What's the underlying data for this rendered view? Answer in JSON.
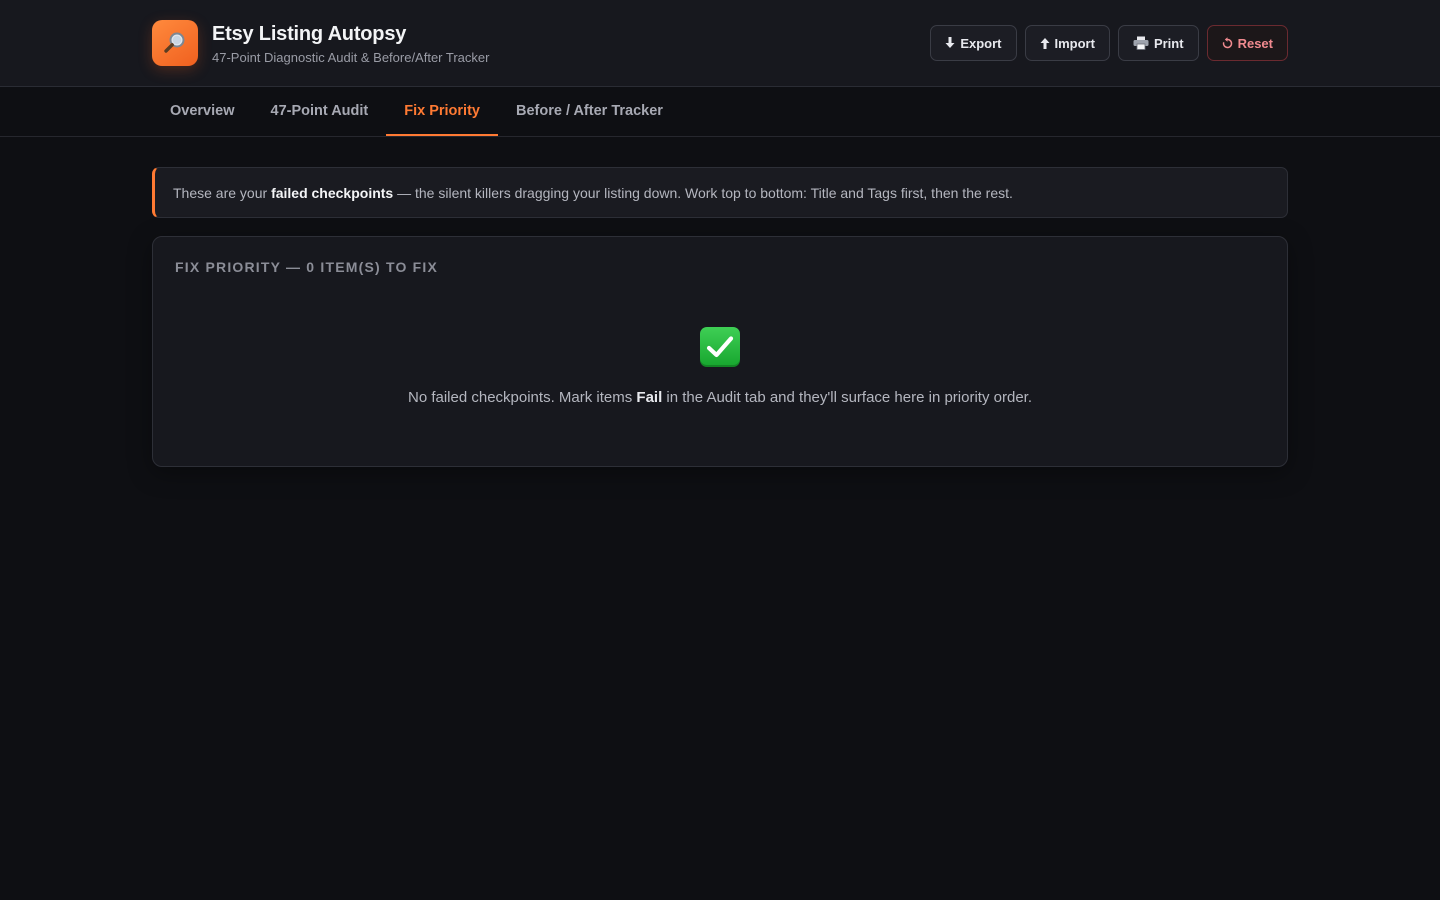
{
  "app": {
    "title": "Etsy Listing Autopsy",
    "subtitle": "47-Point Diagnostic Audit & Before/After Tracker",
    "logo_icon": "magnifier-icon"
  },
  "toolbar": {
    "export_label": "Export",
    "import_label": "Import",
    "print_label": "Print",
    "reset_label": "Reset"
  },
  "tabs": [
    {
      "label": "Overview",
      "active": false
    },
    {
      "label": "47-Point Audit",
      "active": false
    },
    {
      "label": "Fix Priority",
      "active": true
    },
    {
      "label": "Before / After Tracker",
      "active": false
    }
  ],
  "banner": {
    "prefix": "These are your ",
    "emphasis": "failed checkpoints",
    "suffix": " — the silent killers dragging your listing down. Work top to bottom: Title and Tags first, then the rest."
  },
  "fix_priority": {
    "title": "Fix Priority — 0 item(s) to fix",
    "empty_prefix": "No failed checkpoints. Mark items ",
    "empty_emphasis": "Fail",
    "empty_suffix": " in the Audit tab and they'll surface here in priority order."
  },
  "colors": {
    "accent": "#ff7a33",
    "background": "#0e0f13",
    "danger": "#f08a8f",
    "success": "#2bbd43"
  }
}
